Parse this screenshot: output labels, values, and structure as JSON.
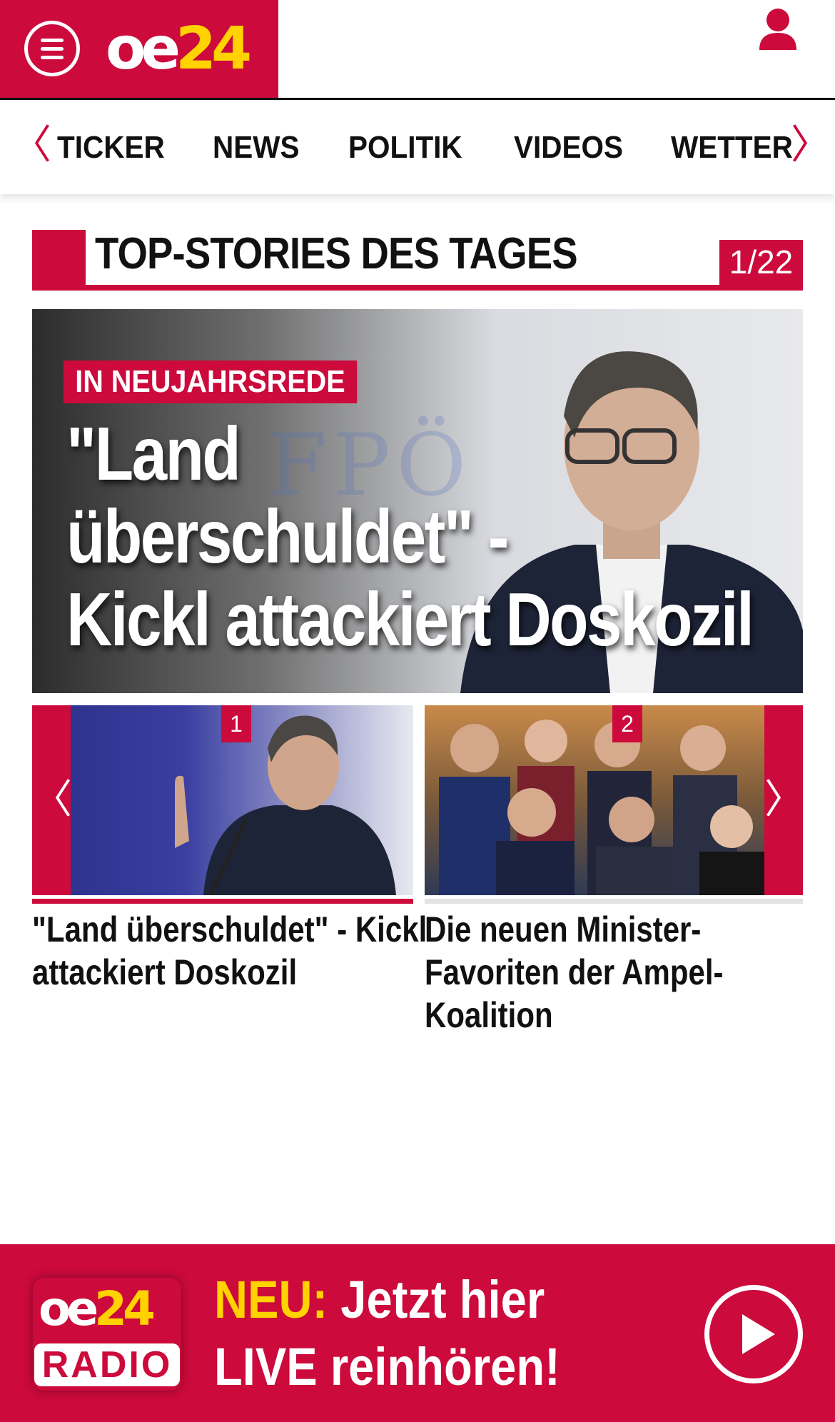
{
  "header": {
    "logo_main": "oe",
    "logo_accent": "24"
  },
  "nav": {
    "prev_arrow": "〈",
    "next_arrow": "〉",
    "items": [
      {
        "label": "TICKER"
      },
      {
        "label": "NEWS"
      },
      {
        "label": "POLITIK"
      },
      {
        "label": "VIDEOS"
      },
      {
        "label": "WETTER"
      }
    ]
  },
  "section": {
    "title": "TOP-STORIES DES TAGES",
    "counter": "1/22"
  },
  "hero": {
    "tag": "IN NEUJAHRSREDE",
    "title_line1": "\"Land",
    "title_line2": "überschuldet\" -",
    "title_line3": "Kickl attackiert Doskozil",
    "bg_text": "FPÖ"
  },
  "cards": [
    {
      "number": "1",
      "title_line1": "\"Land überschuldet\" - Kickl",
      "title_line2": "attackiert Doskozil",
      "title_line3": ""
    },
    {
      "number": "2",
      "title_line1": "Die neuen Minister-",
      "title_line2": "Favoriten der Ampel-",
      "title_line3": "Koalition"
    }
  ],
  "carousel": {
    "prev_arrow": "〈",
    "next_arrow": "〉"
  },
  "radio": {
    "logo_main": "oe",
    "logo_accent": "24",
    "logo_word": "RADIO",
    "neu": "NEU:",
    "line1_rest": " Jetzt hier",
    "line2": "LIVE reinhören!"
  },
  "colors": {
    "brand_red": "#cc0a3c",
    "brand_yellow": "#ffd200"
  },
  "icons": [
    "hamburger-menu-icon",
    "user-icon",
    "play-icon"
  ]
}
